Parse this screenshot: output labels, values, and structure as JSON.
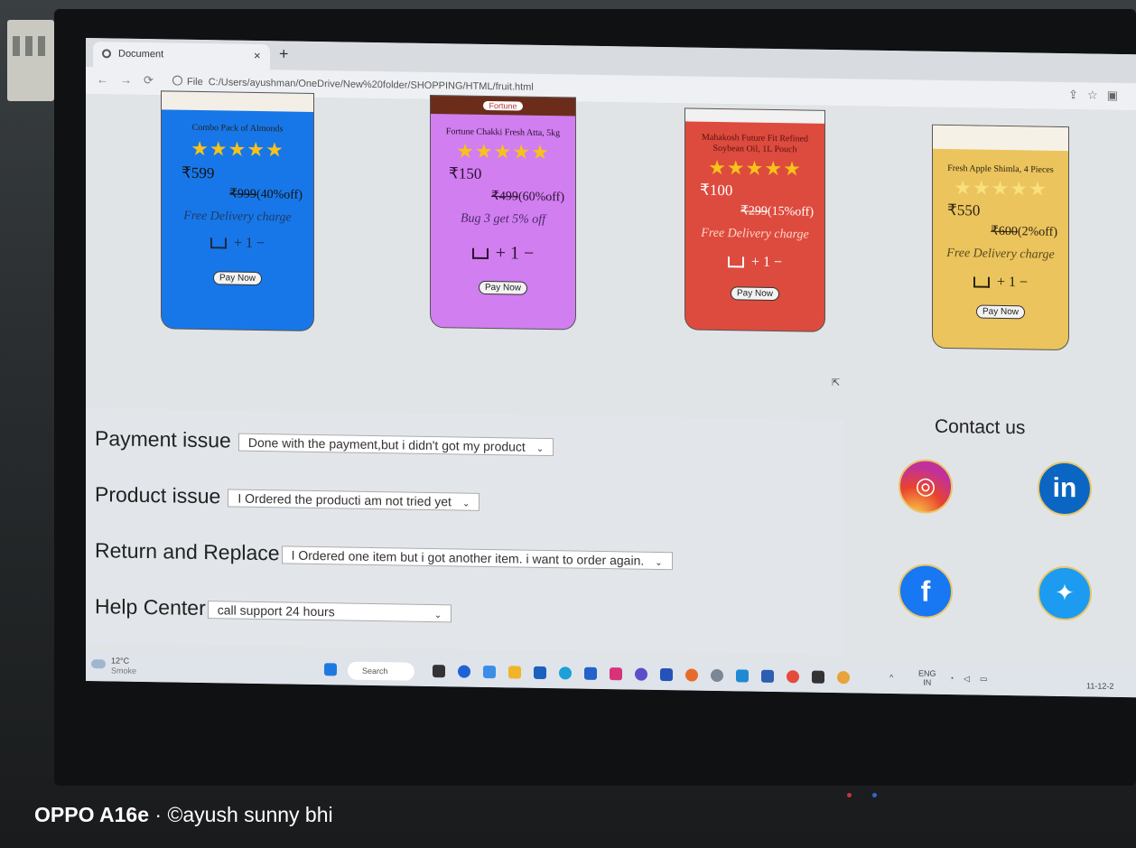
{
  "browser": {
    "tab_title": "Document",
    "tab_close": "×",
    "new_tab": "+",
    "address_prefix": "File",
    "address_url": "C:/Users/ayushman/OneDrive/New%20folder/SHOPPING/HTML/fruit.html"
  },
  "products": [
    {
      "name": "Combo Pack of Almonds",
      "stars": "★★★★★",
      "price": "₹599",
      "mrp": "₹999",
      "discount": "(40%off)",
      "note": "Free Delivery charge",
      "qty_text": "+ 1 −",
      "pay_label": "Pay Now",
      "bg": "#1877e8",
      "text_color": "#ffffff"
    },
    {
      "name": "Fortune Chakki Fresh Atta, 5kg",
      "banner": "Fortune",
      "stars": "★★★★★",
      "price": "₹150",
      "mrp": "₹499",
      "discount": "(60%off)",
      "note": "Bug 3 get 5% off",
      "qty_text": "+ 1 −",
      "pay_label": "Pay Now",
      "bg": "#d17ef0",
      "text_color": "#2a1030"
    },
    {
      "name": "Mahakosh Future Fit Refined Soybean Oil, 1L Pouch",
      "stars": "★★★★★",
      "price": "₹100",
      "mrp": "₹299",
      "discount": "(15%off)",
      "note": "Free Delivery charge",
      "qty_text": "+ 1 −",
      "pay_label": "Pay Now",
      "bg": "#dd4b3e",
      "text_color": "#ffffff"
    },
    {
      "name": "Fresh Apple Shimla, 4 Pieces",
      "stars": "★★★★★",
      "price": "₹550",
      "mrp": "₹600",
      "discount": "(2%off)",
      "note": "Free Delivery charge",
      "qty_text": "+ 1 −",
      "pay_label": "Pay Now",
      "bg": "#ebc45d",
      "text_color": "#2a2210"
    }
  ],
  "support": {
    "payment": {
      "label": "Payment issue",
      "value": "Done with the payment,but i didn't got my product"
    },
    "product": {
      "label": "Product issue",
      "value": "I Ordered the producti am not tried yet"
    },
    "return": {
      "label": "Return and Replace",
      "value": "I Ordered one item but i got another item. i want to order again."
    },
    "help": {
      "label": "Help Center",
      "value": "call support 24 hours"
    }
  },
  "contact": {
    "title": "Contact us"
  },
  "taskbar": {
    "weather_temp": "12°C",
    "weather_desc": "Smoke",
    "search": "Search",
    "lang_top": "ENG",
    "lang_bottom": "IN",
    "date": "11-12-2"
  },
  "watermark": {
    "device": "OPPO A16e",
    "separator": " · ",
    "author": "©ayush sunny bhi"
  }
}
